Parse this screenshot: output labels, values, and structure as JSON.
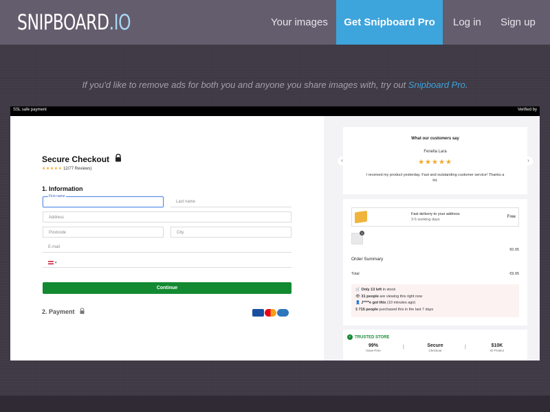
{
  "header": {
    "logo_main": "SNIPBOARD",
    "logo_tld": ".IO",
    "nav": {
      "your_images": "Your images",
      "get_pro": "Get Snipboard Pro",
      "log_in": "Log in",
      "sign_up": "Sign up"
    }
  },
  "promo": {
    "text": "If you'd like to remove ads for both you and anyone you share images with, try out ",
    "link": "Snipboard Pro",
    "suffix": "."
  },
  "screenshot": {
    "top_bar": {
      "left": "SSL safe payment",
      "right": "Verified by"
    },
    "checkout": {
      "title": "Secure Checkout",
      "stars": "★★★★★",
      "reviews": "12/77 Reviews)",
      "section_information": "1. Information",
      "first_name_label": "First name",
      "last_name_placeholder": "Last name",
      "address_placeholder": "Address",
      "postcode_placeholder": "Postcode",
      "city_placeholder": "City",
      "email_placeholder": "E-mail",
      "phone_code": "▾",
      "continue_label": "Continue",
      "section_payment": "2. Payment"
    },
    "testimonial": {
      "heading": "What our customers say",
      "name": "Fenella Lara",
      "stars": "★★★★★",
      "text": "I received my product yesterday. Fast and outstanding customer service! Thanks a lot.",
      "prev": "‹",
      "next": "›"
    },
    "summary": {
      "shipping_line1": "Fast delivery to your address",
      "shipping_line2": "3-5 working days",
      "shipping_price": "Free",
      "thumb_badge": "1",
      "item_price": "€0.95",
      "order_summary": "Order Summary",
      "total_label": "Total",
      "total_value": "€9.95",
      "alerts": [
        {
          "icon": "🛒",
          "bold": "Only 13 left",
          "rest": " in stock"
        },
        {
          "icon": "👁",
          "bold": "31 people",
          "rest": " are viewing this right now"
        },
        {
          "icon": "👤",
          "bold": "J****e got this",
          "rest": " (10 minutes ago)"
        },
        {
          "icon": "$",
          "bold": "715 people",
          "rest": " purchased this in the last 7 days"
        }
      ]
    },
    "trust": {
      "heading": "TRUSTED STORE",
      "items": [
        {
          "value": "99%",
          "label": "Issue-Free"
        },
        {
          "value": "Secure",
          "label": "Checkout"
        },
        {
          "value": "$10K",
          "label": "ID Protect"
        }
      ]
    }
  },
  "colors": {
    "header_bg": "#645d6d",
    "page_bg": "#3f3a45",
    "accent": "#3ea4dc",
    "checkout_green": "#138a32",
    "star": "#f5a623"
  }
}
